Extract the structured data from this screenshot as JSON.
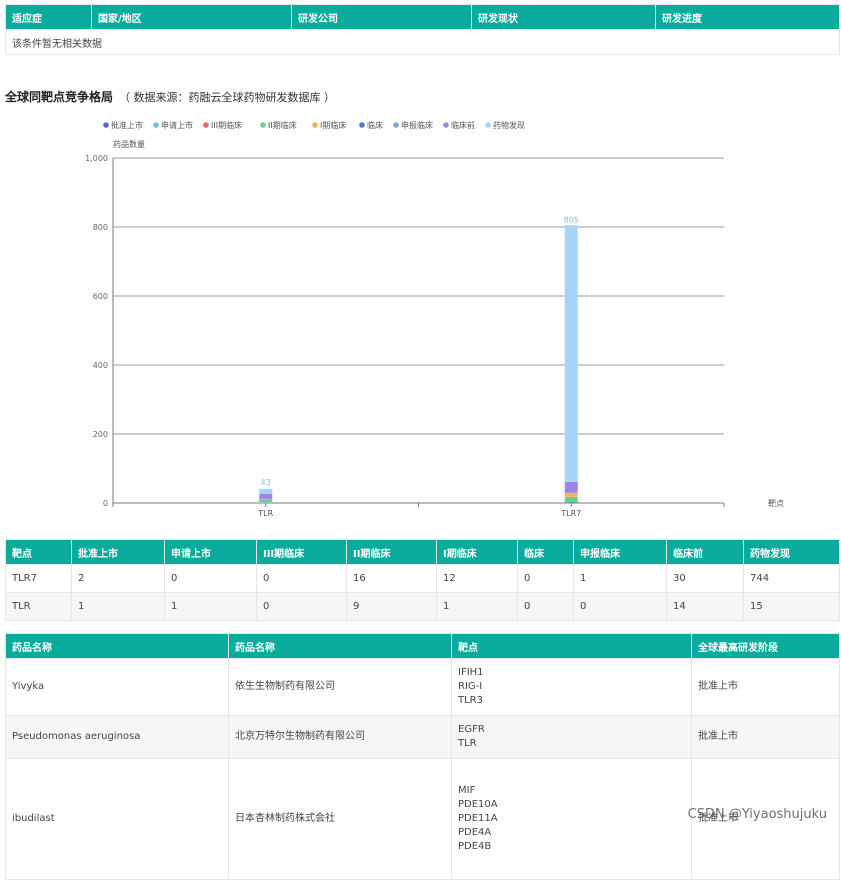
{
  "indication_table": {
    "headers": [
      "适应症",
      "国家/地区",
      "研发公司",
      "研发现状",
      "研发进度"
    ],
    "empty_text": "该条件暂无相关数据"
  },
  "section": {
    "title": "全球同靶点竞争格局",
    "source": "（ 数据来源：药融云全球药物研发数据库 ）"
  },
  "chart_data": {
    "type": "bar",
    "stacked": true,
    "ylabel": "药品数量",
    "xlabel": "靶点",
    "ylim": [
      0,
      1000
    ],
    "yticks": [
      "0",
      "200",
      "400",
      "600",
      "800",
      "1,000"
    ],
    "grid": true,
    "legend_position": "top",
    "categories": [
      "TLR",
      "TLR7"
    ],
    "totals": [
      43,
      805
    ],
    "series": [
      {
        "name": "批准上市",
        "color": "#5470c6",
        "values": [
          1,
          2
        ]
      },
      {
        "name": "申请上市",
        "color": "#73c0de",
        "values": [
          1,
          0
        ]
      },
      {
        "name": "III期临床",
        "color": "#ee6666",
        "values": [
          0,
          0
        ]
      },
      {
        "name": "II期临床",
        "color": "#6fcf8a",
        "values": [
          9,
          16
        ]
      },
      {
        "name": "I期临床",
        "color": "#f5b15c",
        "values": [
          1,
          12
        ]
      },
      {
        "name": "临床",
        "color": "#4c79c4",
        "values": [
          0,
          0
        ]
      },
      {
        "name": "申报临床",
        "color": "#7fa8dc",
        "values": [
          0,
          1
        ]
      },
      {
        "name": "临床前",
        "color": "#a483e0",
        "values": [
          14,
          30
        ]
      },
      {
        "name": "药物发现",
        "color": "#a7d3f7",
        "values": [
          15,
          744
        ]
      }
    ]
  },
  "target_table": {
    "headers": [
      "靶点",
      "批准上市",
      "申请上市",
      "III期临床",
      "II期临床",
      "I期临床",
      "临床",
      "申报临床",
      "临床前",
      "药物发现"
    ],
    "rows": [
      [
        "TLR7",
        "2",
        "0",
        "0",
        "16",
        "12",
        "0",
        "1",
        "30",
        "744"
      ],
      [
        "TLR",
        "1",
        "1",
        "0",
        "9",
        "1",
        "0",
        "0",
        "14",
        "15"
      ]
    ]
  },
  "drug_table": {
    "headers": [
      "药品名称",
      "药品名称",
      "靶点",
      "全球最高研发阶段"
    ],
    "rows": [
      {
        "name": "Yivyka",
        "company": "依生生物制药有限公司",
        "targets": [
          "IFIH1",
          "RIG-I",
          "TLR3"
        ],
        "stage": "批准上市"
      },
      {
        "name": "Pseudomonas aeruginosa",
        "company": "北京万特尔生物制药有限公司",
        "targets": [
          "EGFR",
          "TLR"
        ],
        "stage": "批准上市"
      },
      {
        "name": "ibudilast",
        "company": "日本杏林制药株式会社",
        "targets": [
          "MIF",
          "PDE10A",
          "PDE11A",
          "PDE4A",
          "PDE4B"
        ],
        "stage": "批准上市"
      }
    ]
  },
  "watermark": "CSDN @Yiyaoshujuku"
}
